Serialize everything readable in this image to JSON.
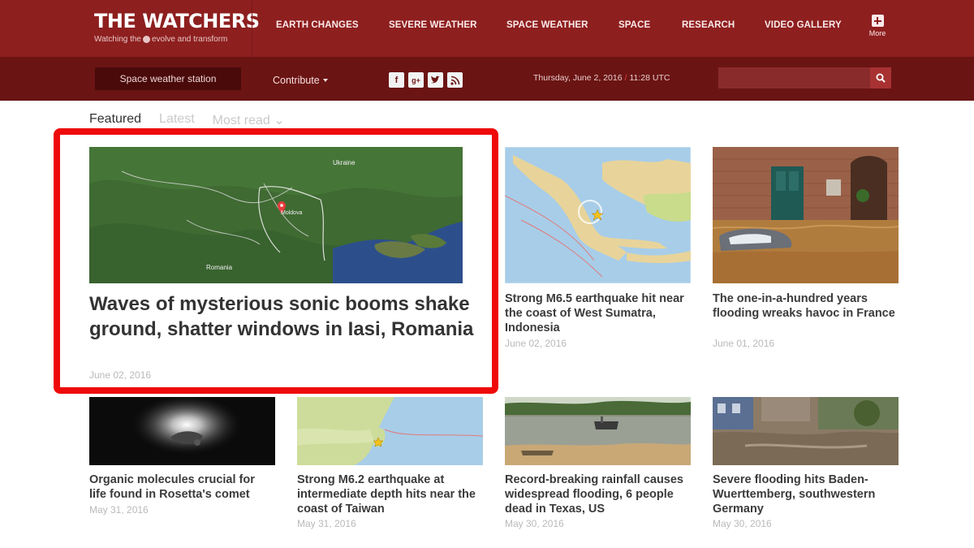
{
  "header": {
    "site_title": "THE WATCHERS",
    "tagline_before": "Watching the",
    "tagline_after": "evolve and transform",
    "nav": [
      "EARTH CHANGES",
      "SEVERE WEATHER",
      "SPACE WEATHER",
      "SPACE",
      "RESEARCH",
      "VIDEO GALLERY"
    ],
    "more_label": "More"
  },
  "subheader": {
    "station_button": "Space weather station",
    "contribute_label": "Contribute",
    "social_icons": [
      "facebook-icon",
      "google-plus-icon",
      "twitter-icon",
      "rss-icon"
    ],
    "date_text": "Thursday, June 2, 2016",
    "time_text": "11:28 UTC",
    "search_placeholder": ""
  },
  "tabs": [
    "Featured",
    "Latest",
    "Most read"
  ],
  "featured": {
    "headline": "Waves of mysterious sonic booms shake ground, shatter windows in Iasi, Romania",
    "date": "June 02, 2016",
    "map_labels": {
      "country_top": "Ukraine",
      "city": "Moldova",
      "country_bottom": "Romania"
    }
  },
  "articles_row1": [
    {
      "headline": "Strong M6.5 earthquake hit near the coast of West Sumatra, Indonesia",
      "date": "June 02, 2016"
    },
    {
      "headline": "The one-in-a-hundred years flooding wreaks havoc in France",
      "date": "June 01, 2016"
    }
  ],
  "articles_row2": [
    {
      "headline": "Organic molecules crucial for life found in Rosetta's comet",
      "date": "May 31, 2016"
    },
    {
      "headline": "Strong M6.2 earthquake at intermediate depth hits near the coast of Taiwan",
      "date": "May 31, 2016"
    },
    {
      "headline": "Record-breaking rainfall causes widespread flooding, 6 people dead in Texas, US",
      "date": "May 30, 2016"
    },
    {
      "headline": "Severe flooding hits Baden-Wuerttemberg, southwestern Germany",
      "date": "May 30, 2016"
    }
  ],
  "colors": {
    "header_bg": "#8e1f1f",
    "subheader_bg": "#6b1414",
    "highlight_border": "#ee0a0a"
  }
}
